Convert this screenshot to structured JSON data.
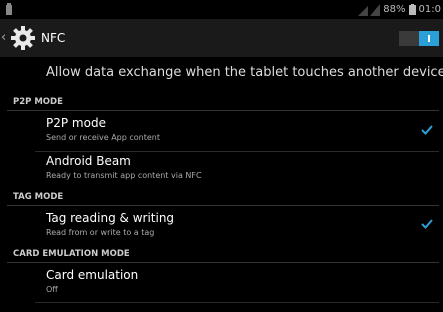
{
  "status_bar": {
    "battery_percent": "88%",
    "time": "01:0",
    "icons": [
      "notification-icon",
      "signal-icon",
      "battery-icon"
    ]
  },
  "action_bar": {
    "back_glyph": "‹",
    "title": "NFC",
    "toggle_on": true,
    "accent_color": "#2a9fd8"
  },
  "description": "Allow data exchange when the tablet touches another device",
  "sections": [
    {
      "header": "P2P MODE",
      "items": [
        {
          "title": "P2P mode",
          "subtitle": "Send or receive App content",
          "checked": true
        },
        {
          "title": "Android Beam",
          "subtitle": "Ready to transmit app content via NFC",
          "checked": false
        }
      ]
    },
    {
      "header": "TAG MODE",
      "items": [
        {
          "title": "Tag reading & writing",
          "subtitle": "Read from or write to a tag",
          "checked": true
        }
      ]
    },
    {
      "header": "CARD EMULATION MODE",
      "items": [
        {
          "title": "Card emulation",
          "subtitle": "Off",
          "checked": false
        }
      ]
    }
  ]
}
